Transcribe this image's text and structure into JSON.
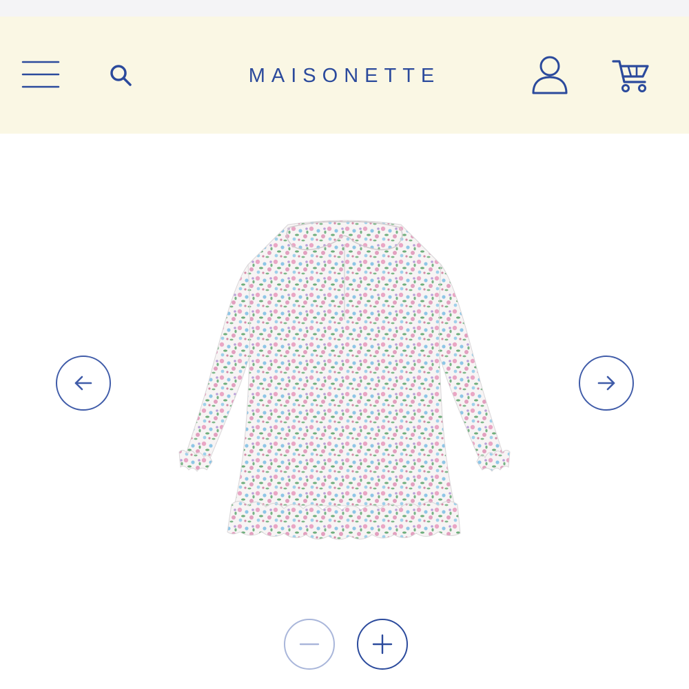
{
  "header": {
    "brand": "MAISONETTE",
    "background": "#faf7e4",
    "accent": "#2b4a9c",
    "icons": {
      "menu": "hamburger-menu-icon",
      "search": "search-icon",
      "account": "user-icon",
      "cart": "shopping-cart-icon"
    }
  },
  "carousel": {
    "product_image": "floral-print-long-sleeve-dress-with-peter-pan-collar-and-ruffle-hem",
    "dress_colors": [
      "#f7f4f4",
      "#e9a6c4",
      "#8ec6e6",
      "#6fae7c",
      "#b99fd8"
    ],
    "prev_icon": "arrow-left-icon",
    "next_icon": "arrow-right-icon"
  },
  "zoom": {
    "zoom_out_icon": "minus-icon",
    "zoom_in_icon": "plus-icon",
    "zoom_out_enabled": false,
    "zoom_in_enabled": true
  }
}
